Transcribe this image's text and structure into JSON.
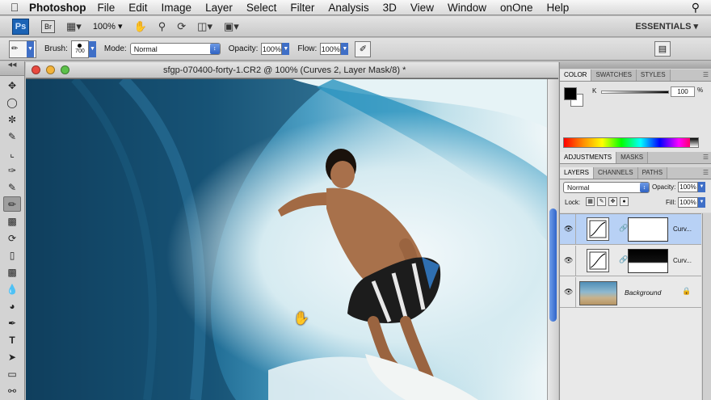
{
  "menubar": {
    "app_name": "Photoshop",
    "items": [
      "File",
      "Edit",
      "Image",
      "Layer",
      "Select",
      "Filter",
      "Analysis",
      "3D",
      "View",
      "Window",
      "onOne",
      "Help"
    ]
  },
  "appbar": {
    "ps_logo": "Ps",
    "br_logo": "Br",
    "zoom": "100%",
    "workspace": "ESSENTIALS"
  },
  "options": {
    "brush_label": "Brush:",
    "brush_size": "700",
    "mode_label": "Mode:",
    "mode_value": "Normal",
    "opacity_label": "Opacity:",
    "opacity_value": "100%",
    "flow_label": "Flow:",
    "flow_value": "100%"
  },
  "document": {
    "title": "sfgp-070400-forty-1.CR2 @ 100% (Curves 2, Layer Mask/8) *"
  },
  "color_panel": {
    "tabs": [
      "COLOR",
      "SWATCHES",
      "STYLES"
    ],
    "channel_label": "K",
    "k_value": "100",
    "k_unit": "%"
  },
  "adjustments_panel": {
    "tabs": [
      "ADJUSTMENTS",
      "MASKS"
    ]
  },
  "layers_panel": {
    "tabs": [
      "LAYERS",
      "CHANNELS",
      "PATHS"
    ],
    "blend_mode": "Normal",
    "opacity_label": "Opacity:",
    "opacity_value": "100%",
    "lock_label": "Lock:",
    "fill_label": "Fill:",
    "fill_value": "100%",
    "layers": [
      {
        "name": "Curv..."
      },
      {
        "name": "Curv..."
      },
      {
        "name": "Background"
      }
    ]
  },
  "colors": {
    "accent": "#3f6fc7",
    "selected_layer": "#b8d1f5",
    "ps_logo": "#1b63b5"
  }
}
